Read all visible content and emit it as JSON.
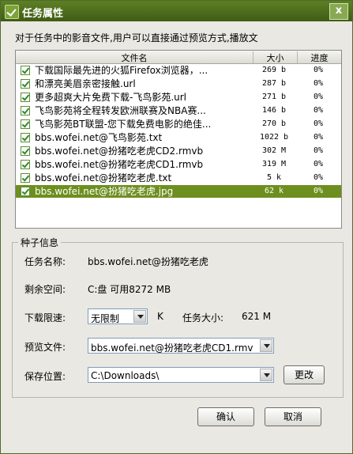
{
  "window": {
    "title": "任务属性",
    "close_label": "x"
  },
  "intro_text": "对于任务中的影音文件,用户可以直接通过预览方式,播放文",
  "file_list": {
    "columns": {
      "name": "文件名",
      "size": "大小",
      "progress": "进度"
    },
    "rows": [
      {
        "name": "下载国际最先进的火狐Firefox浏览器，...",
        "size": "269 b",
        "progress": "0%",
        "checked": true
      },
      {
        "name": "和漂亮美眉亲密接触.url",
        "size": "287 b",
        "progress": "0%",
        "checked": true
      },
      {
        "name": "更多超爽大片免费下载-飞鸟影苑.url",
        "size": "271 b",
        "progress": "0%",
        "checked": true
      },
      {
        "name": "飞鸟影苑将全程转发欧洲联赛及NBA赛...",
        "size": "146 b",
        "progress": "0%",
        "checked": true
      },
      {
        "name": "飞鸟影苑BT联盟-您下载免费电影的绝佳...",
        "size": "270 b",
        "progress": "0%",
        "checked": true
      },
      {
        "name": "bbs.wofei.net@飞鸟影苑.txt",
        "size": "1022 b",
        "progress": "0%",
        "checked": true
      },
      {
        "name": "bbs.wofei.net@扮猪吃老虎CD2.rmvb",
        "size": "302 M",
        "progress": "0%",
        "checked": true
      },
      {
        "name": "bbs.wofei.net@扮猪吃老虎CD1.rmvb",
        "size": "319 M",
        "progress": "0%",
        "checked": true
      },
      {
        "name": "bbs.wofei.net@扮猪吃老虎.txt",
        "size": "5 k",
        "progress": "0%",
        "checked": true
      },
      {
        "name": "bbs.wofei.net@扮猪吃老虎.jpg",
        "size": "62 k",
        "progress": "0%",
        "checked": true,
        "selected": true
      }
    ]
  },
  "seed_info": {
    "group_title": "种子信息",
    "task_name_label": "任务名称:",
    "task_name": "bbs.wofei.net@扮猪吃老虎",
    "free_space_label": "剩余空间:",
    "free_space": "C:盘 可用8272 MB",
    "speed_limit_label": "下载限速:",
    "speed_limit_value": "无限制",
    "speed_unit": "K",
    "task_size_label": "任务大小:",
    "task_size": "621 M",
    "preview_label": "预览文件:",
    "preview_value": "bbs.wofei.net@扮猪吃老虎CD1.rmv",
    "save_location_label": "保存位置:",
    "save_location_value": "C:\\Downloads\\",
    "change_button": "更改"
  },
  "buttons": {
    "ok": "确认",
    "cancel": "取消"
  },
  "colors": {
    "title_bar": "#4f6e1d",
    "selection": "#6d8f1f",
    "dialog_bg": "#e9e8e2",
    "check": "#2f8a28"
  }
}
